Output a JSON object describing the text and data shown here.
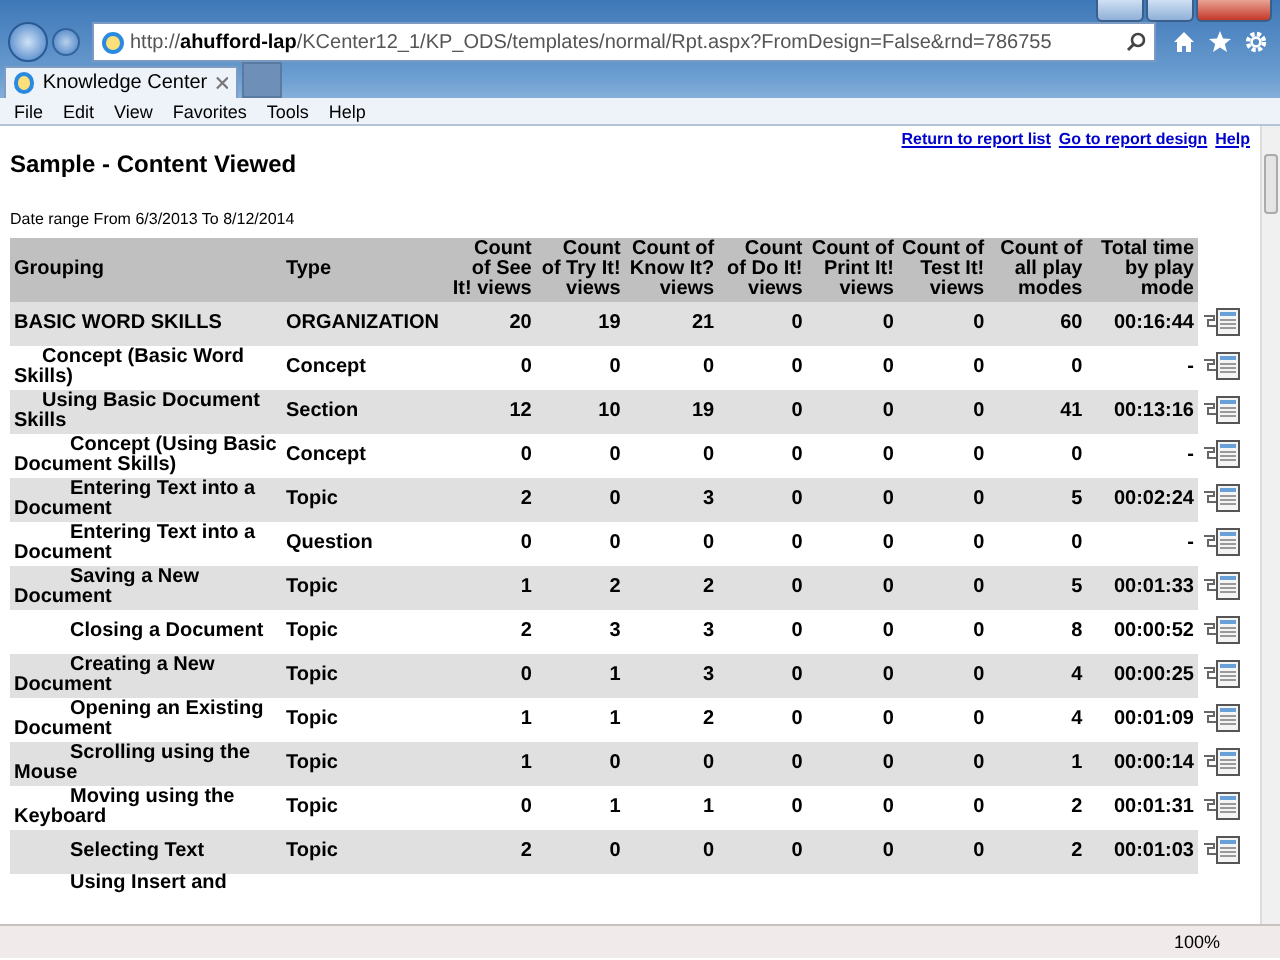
{
  "browser": {
    "url": "http://**ahufford-lap**/KCenter12_1/KP_ODS/templates/normal/Rpt.aspx?FromDesign=False&rnd=786755",
    "tabs": [
      {
        "title": "Knowledge Center",
        "selected": true
      }
    ],
    "menu": [
      "File",
      "Edit",
      "View",
      "Favorites",
      "Tools",
      "Help"
    ]
  },
  "report": {
    "title": "Sample - Content Viewed",
    "links": [
      "Return to report list",
      "Go to report design",
      "Help"
    ],
    "date_range": "Date range From 6/3/2013 To 8/12/2014",
    "table": {
      "columns": [
        "Grouping",
        "Type",
        "Count of See It! views",
        "Count of Try It! views",
        "Count of Know It? views",
        "Count of Do It! views",
        "Count of Print It! views",
        "Count of Test It! views",
        "Count of all play modes",
        "Total time by play mode"
      ],
      "rows": [
        {
          "grouping": "BASIC WORD SKILLS",
          "type": "ORGANIZATION",
          "values": [
            "20",
            "19",
            "21",
            "0",
            "0",
            "0",
            "60",
            "00:16:44"
          ],
          "children": [
            {
              "grouping": "Concept (Basic Word Skills)",
              "type": "Concept",
              "values": [
                "0",
                "0",
                "0",
                "0",
                "0",
                "0",
                "0",
                "-"
              ]
            },
            {
              "grouping": "Using Basic Document Skills",
              "type": "Section",
              "values": [
                "12",
                "10",
                "19",
                "0",
                "0",
                "0",
                "41",
                "00:13:16"
              ],
              "children": [
                {
                  "grouping": "Concept (Using Basic Document Skills)",
                  "type": "Concept",
                  "values": [
                    "0",
                    "0",
                    "0",
                    "0",
                    "0",
                    "0",
                    "0",
                    "-"
                  ]
                },
                {
                  "grouping": "Entering Text into a Document",
                  "type": "Topic",
                  "values": [
                    "2",
                    "0",
                    "3",
                    "0",
                    "0",
                    "0",
                    "5",
                    "00:02:24"
                  ]
                },
                {
                  "grouping": "Entering Text into a Document",
                  "type": "Question",
                  "values": [
                    "0",
                    "0",
                    "0",
                    "0",
                    "0",
                    "0",
                    "0",
                    "-"
                  ]
                },
                {
                  "grouping": "Saving a New Document",
                  "type": "Topic",
                  "values": [
                    "1",
                    "2",
                    "2",
                    "0",
                    "0",
                    "0",
                    "5",
                    "00:01:33"
                  ]
                },
                {
                  "grouping": "Closing a Document",
                  "type": "Topic",
                  "values": [
                    "2",
                    "3",
                    "3",
                    "0",
                    "0",
                    "0",
                    "8",
                    "00:00:52"
                  ]
                },
                {
                  "grouping": "Creating a New Document",
                  "type": "Topic",
                  "values": [
                    "0",
                    "1",
                    "3",
                    "0",
                    "0",
                    "0",
                    "4",
                    "00:00:25"
                  ]
                },
                {
                  "grouping": "Opening an Existing Document",
                  "type": "Topic",
                  "values": [
                    "1",
                    "1",
                    "2",
                    "0",
                    "0",
                    "0",
                    "4",
                    "00:01:09"
                  ]
                },
                {
                  "grouping": "Scrolling using the Mouse",
                  "type": "Topic",
                  "values": [
                    "1",
                    "0",
                    "0",
                    "0",
                    "0",
                    "0",
                    "1",
                    "00:00:14"
                  ]
                },
                {
                  "grouping": "Moving using the Keyboard",
                  "type": "Topic",
                  "values": [
                    "0",
                    "1",
                    "1",
                    "0",
                    "0",
                    "0",
                    "2",
                    "00:01:31"
                  ]
                },
                {
                  "grouping": "Selecting Text",
                  "type": "Topic",
                  "values": [
                    "2",
                    "0",
                    "0",
                    "0",
                    "0",
                    "0",
                    "2",
                    "00:01:03"
                  ]
                },
                {
                  "grouping": "Using Insert and"
                }
              ]
            }
          ]
        }
      ]
    }
  },
  "status_bar": {
    "zoom": "100%"
  }
}
